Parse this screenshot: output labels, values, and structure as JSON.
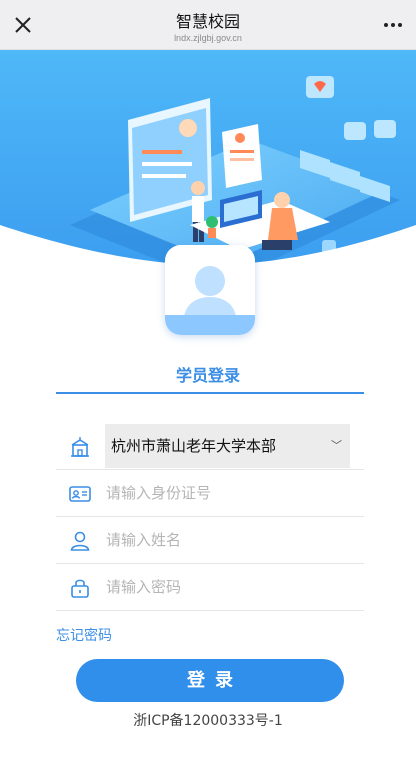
{
  "header": {
    "title": "智慧校园",
    "url": "lndx.zjlgbj.gov.cn"
  },
  "icons": {
    "close": "close-icon",
    "more": "more-icon",
    "school": "school-building-icon",
    "id_card": "id-card-icon",
    "user": "user-icon",
    "lock": "lock-icon",
    "avatar": "avatar-placeholder-icon"
  },
  "login": {
    "tab_label": "学员登录",
    "school_value": "杭州市萧山老年大学本部",
    "id_placeholder": "请输入身份证号",
    "name_placeholder": "请输入姓名",
    "password_placeholder": "请输入密码",
    "forgot_label": "忘记密码",
    "submit_label": "登录"
  },
  "footer": {
    "icp": "浙ICP备12000333号-1"
  },
  "colors": {
    "accent": "#3b8ee6",
    "button": "#2f8fea",
    "hero_bg": "#3fa6f5"
  }
}
